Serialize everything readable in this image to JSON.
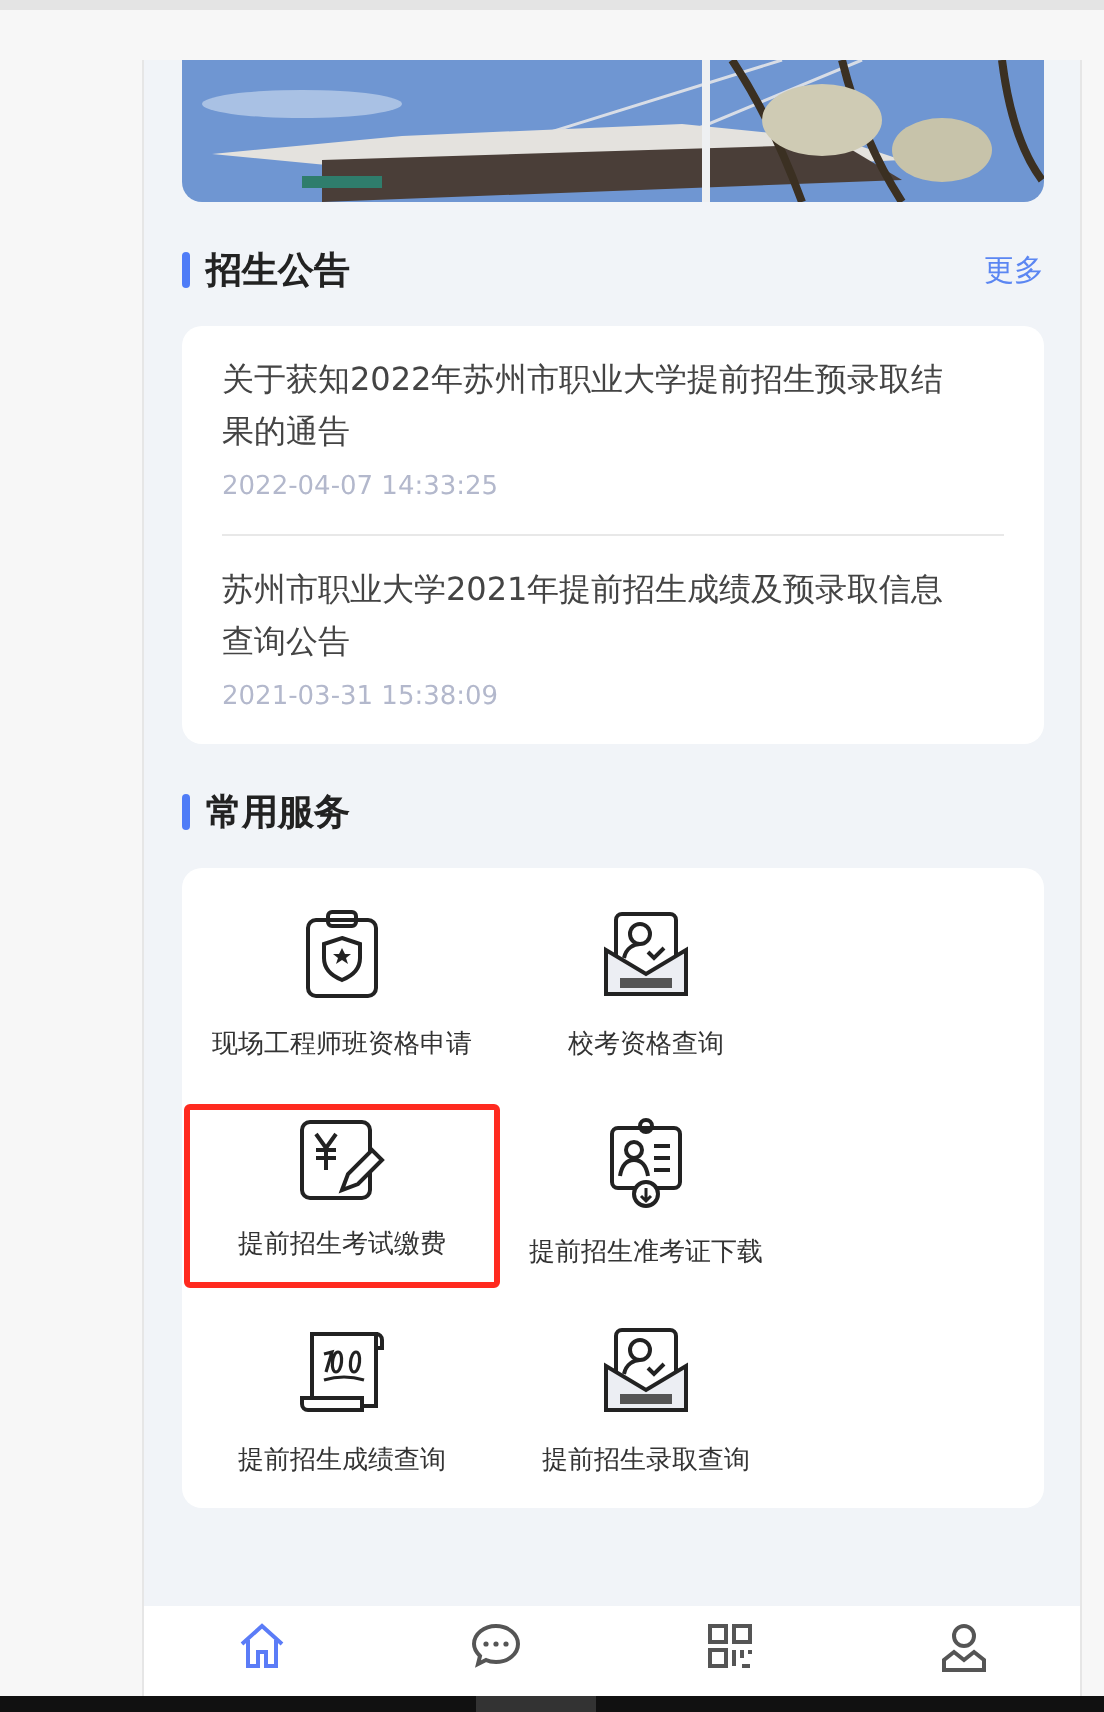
{
  "notices": {
    "title": "招生公告",
    "more": "更多",
    "items": [
      {
        "title": "关于获知2022年苏州市职业大学提前招生预录取结果的通告",
        "time": "2022-04-07 14:33:25"
      },
      {
        "title": "苏州市职业大学2021年提前招生成绩及预录取信息查询公告",
        "time": "2021-03-31 15:38:09"
      }
    ]
  },
  "services": {
    "title": "常用服务",
    "items": [
      {
        "label": "现场工程师班资格申请",
        "kind": "clipboard",
        "highlighted": false
      },
      {
        "label": "校考资格查询",
        "kind": "envelope",
        "highlighted": false
      },
      {
        "label": "提前招生考试缴费",
        "kind": "payment",
        "highlighted": true
      },
      {
        "label": "提前招生准考证下载",
        "kind": "badge",
        "highlighted": false
      },
      {
        "label": "提前招生成绩查询",
        "kind": "scroll",
        "highlighted": false
      },
      {
        "label": "提前招生录取查询",
        "kind": "envelope",
        "highlighted": false
      }
    ]
  },
  "tabbar": [
    {
      "kind": "home",
      "selected": true
    },
    {
      "kind": "chat",
      "selected": false
    },
    {
      "kind": "grid",
      "selected": false
    },
    {
      "kind": "user",
      "selected": false
    }
  ]
}
